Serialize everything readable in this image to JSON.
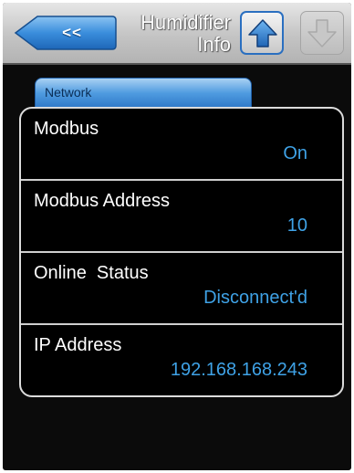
{
  "header": {
    "back_label": "<<",
    "title_line1": "Humidifier",
    "title_line2": "Info",
    "up_icon": "arrow-up-icon",
    "down_icon": "arrow-down-icon"
  },
  "tab": {
    "label": "Network"
  },
  "rows": [
    {
      "name": "Modbus",
      "value": "On"
    },
    {
      "name": "Modbus Address",
      "value": "10"
    },
    {
      "name": "Online  Status",
      "value": "Disconnect'd"
    },
    {
      "name": "IP Address",
      "value": "192.168.168.243"
    }
  ],
  "colors": {
    "accent_blue": "#3fa2e6",
    "button_blue": "#2a7fd0",
    "background": "#0b0b0b"
  }
}
